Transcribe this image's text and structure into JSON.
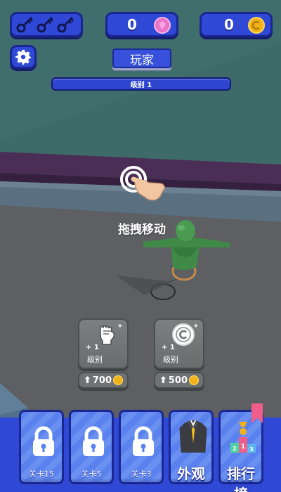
{
  "hud": {
    "keys_icons": [
      "key-icon",
      "key-icon",
      "key-icon"
    ],
    "gems_count": "0",
    "gems_icon": "gem-icon",
    "coins_count": "0",
    "coins_icon": "coin-icon",
    "settings_icon": "gear-icon"
  },
  "player": {
    "name": "玩家",
    "level_label": "级别 1"
  },
  "tutorial": {
    "hint": "拖拽移动",
    "icon": "tap-hand-icon"
  },
  "upgrades": [
    {
      "icon": "fist-icon",
      "plus": "+ 1",
      "level_label": "级别",
      "price": "700",
      "price_icon": "coin-icon"
    },
    {
      "icon": "coin-icon",
      "plus": "+ 1",
      "level_label": "级别",
      "price": "500",
      "price_icon": "coin-icon"
    }
  ],
  "dock": [
    {
      "label": "关卡15",
      "icon": "lock-icon",
      "locked": true
    },
    {
      "label": "关卡5",
      "icon": "lock-icon",
      "locked": true
    },
    {
      "label": "关卡3",
      "icon": "lock-icon",
      "locked": true
    },
    {
      "label": "外观",
      "icon": "suit-icon",
      "locked": false
    },
    {
      "label": "排行榜",
      "icon": "podium-icon",
      "locked": false
    }
  ],
  "colors": {
    "hud_blue": "#2f49d6",
    "hud_border": "#1a2790",
    "gem_pink": "#e873c8",
    "coin_gold": "#f2b21a",
    "floor_gray": "#5e5f62",
    "wall_teal": "#3e6b69",
    "character_green": "#3f8a47"
  }
}
